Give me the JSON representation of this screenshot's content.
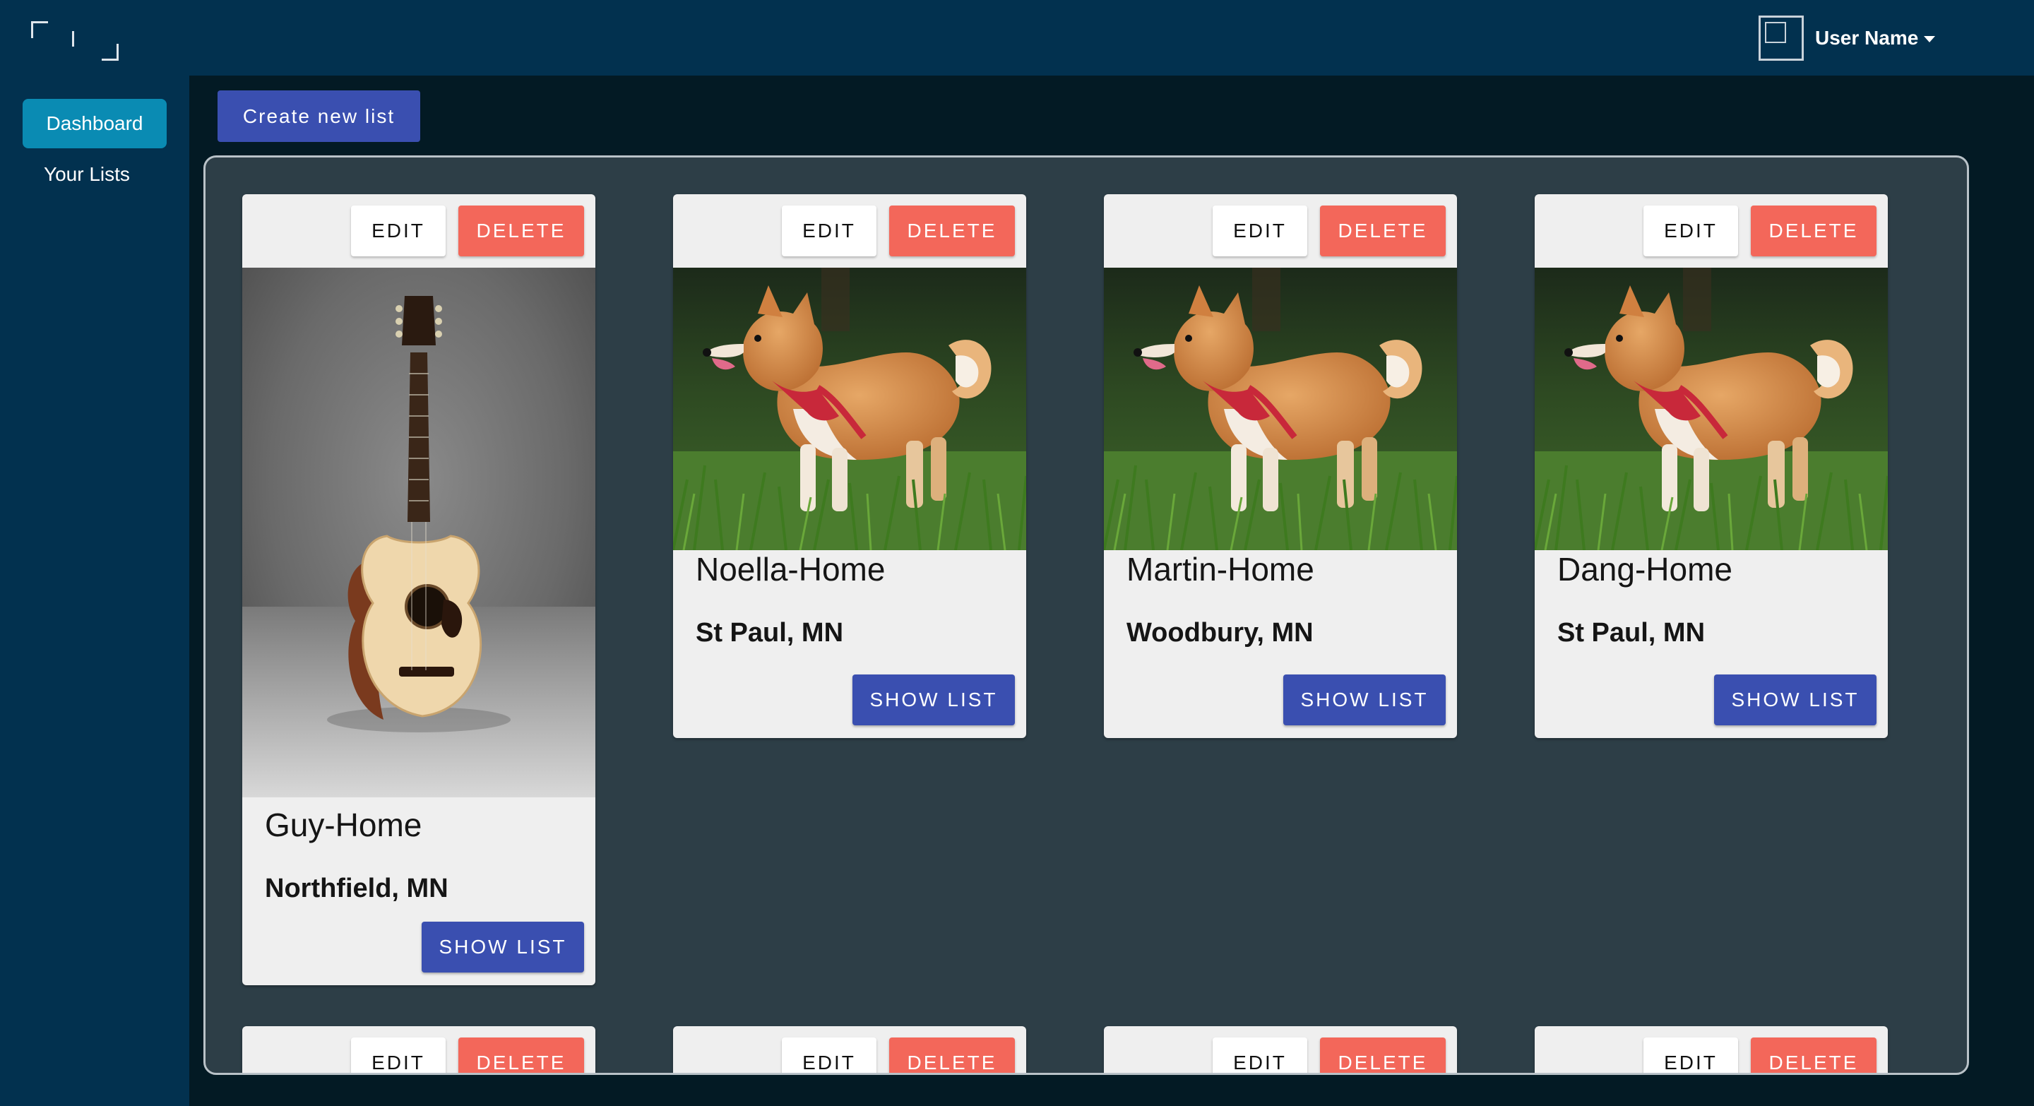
{
  "header": {
    "user_name": "User Name",
    "brand_color": "#02314f"
  },
  "sidebar": {
    "items": [
      {
        "label": "Dashboard",
        "active": true
      },
      {
        "label": "Your Lists",
        "active": false
      }
    ]
  },
  "main": {
    "create_label": "Create new list"
  },
  "cards": [
    {
      "title": "Guy-Home",
      "location": "Northfield, MN",
      "image": "guitar-image",
      "edit_label": "EDIT",
      "delete_label": "DELETE",
      "show_label": "SHOW LIST"
    },
    {
      "title": "Noella-Home",
      "location": "St Paul, MN",
      "image": "dog-image",
      "edit_label": "EDIT",
      "delete_label": "DELETE",
      "show_label": "SHOW LIST"
    },
    {
      "title": "Martin-Home",
      "location": "Woodbury, MN",
      "image": "dog-image",
      "edit_label": "EDIT",
      "delete_label": "DELETE",
      "show_label": "SHOW LIST"
    },
    {
      "title": "Dang-Home",
      "location": "St Paul, MN",
      "image": "dog-image",
      "edit_label": "EDIT",
      "delete_label": "DELETE",
      "show_label": "SHOW LIST"
    }
  ],
  "partial_cards": [
    {
      "edit_label": "EDIT",
      "delete_label": "DELETE"
    },
    {
      "edit_label": "EDIT",
      "delete_label": "DELETE"
    },
    {
      "edit_label": "EDIT",
      "delete_label": "DELETE"
    },
    {
      "edit_label": "EDIT",
      "delete_label": "DELETE"
    }
  ],
  "colors": {
    "primary": "#3a4fb0",
    "danger": "#f3675a",
    "active_nav": "#0a8bb3",
    "panel": "#2d3e47"
  }
}
